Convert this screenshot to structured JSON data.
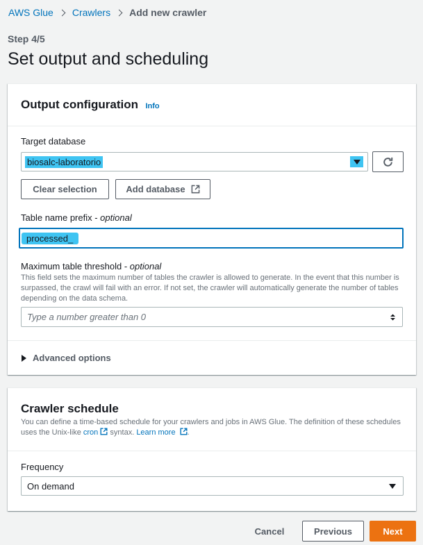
{
  "breadcrumb": {
    "items": [
      "AWS Glue",
      "Crawlers"
    ],
    "current": "Add new crawler"
  },
  "step": "Step 4/5",
  "page_title": "Set output and scheduling",
  "output_config": {
    "title": "Output configuration",
    "info": "Info",
    "target_db_label": "Target database",
    "target_db_value": "biosalc-laboratorio",
    "clear_selection": "Clear selection",
    "add_database": "Add database",
    "prefix_label": "Table name prefix - ",
    "prefix_optional": "optional",
    "prefix_value": "processed_",
    "threshold_label": "Maximum table threshold - ",
    "threshold_optional": "optional",
    "threshold_desc": "This field sets the maximum number of tables the crawler is allowed to generate. In the event that this number is surpassed, the crawl will fail with an error. If not set, the crawler will automatically generate the number of tables depending on the data schema.",
    "threshold_placeholder": "Type a number greater than 0",
    "advanced": "Advanced options"
  },
  "schedule": {
    "title": "Crawler schedule",
    "desc_1": "You can define a time-based schedule for your crawlers and jobs in AWS Glue. The definition of these schedules uses the Unix-like ",
    "cron": "cron",
    "desc_2": " syntax. ",
    "learn_more": "Learn more",
    "desc_3": ".",
    "frequency_label": "Frequency",
    "frequency_value": "On demand"
  },
  "footer": {
    "cancel": "Cancel",
    "previous": "Previous",
    "next": "Next"
  },
  "colors": {
    "link": "#0073bb",
    "primary": "#ec7211",
    "highlight": "#3fc4f2"
  },
  "icons": [
    "chevron-right-icon",
    "refresh-icon",
    "external-link-icon",
    "caret-down-icon",
    "spinner-arrows-icon",
    "caret-right-icon"
  ]
}
